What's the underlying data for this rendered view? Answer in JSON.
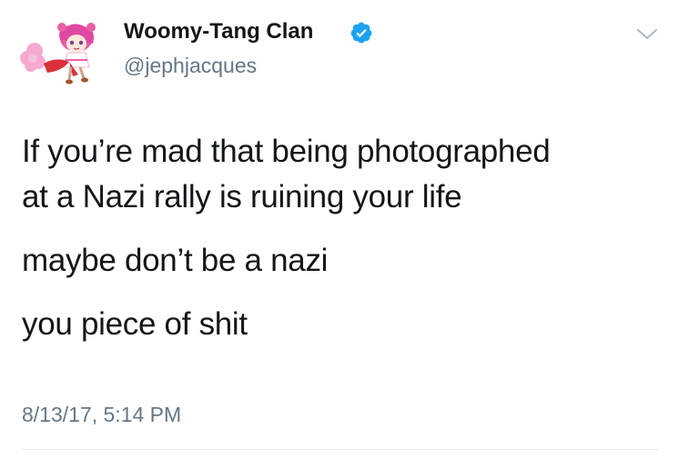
{
  "author": {
    "display_name": "Woomy-Tang Clan",
    "handle": "@jephjacques",
    "verified": true,
    "avatar_icon": "anime-character-avatar-icon"
  },
  "tweet": {
    "lines": [
      "If you’re mad that being photographed",
      "at a Nazi rally is ruining your life",
      "maybe don’t be a nazi",
      "you piece of shit"
    ],
    "timestamp": "8/13/17, 5:14 PM"
  },
  "icons": {
    "verified": "verified-badge-icon",
    "menu": "chevron-down-icon"
  },
  "colors": {
    "text": "#14171a",
    "secondary_text": "#657786",
    "verified_blue": "#1da1f2",
    "divider": "#e1e8ed",
    "avatar_pink": "#e85fa8"
  }
}
